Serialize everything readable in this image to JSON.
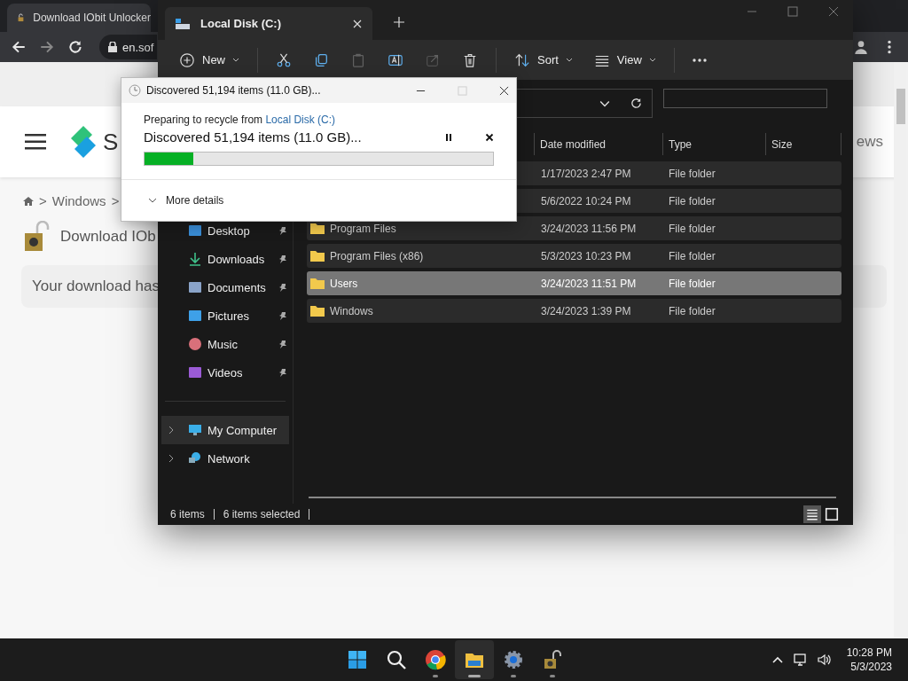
{
  "browser": {
    "tab_title": "Download IObit Unlocker",
    "address": "en.sof",
    "logo_text": "S",
    "breadcrumb": [
      ">",
      "Windows",
      ">"
    ],
    "page_title": "Download IOb",
    "notice": "Your download has",
    "side_text": "ews"
  },
  "explorer": {
    "tabs": [
      {
        "label": "Local Disk (C:)",
        "selected": true
      }
    ],
    "toolbar": [
      {
        "kind": "new",
        "label": "New",
        "disabled": false
      },
      {
        "kind": "cut",
        "disabled": false
      },
      {
        "kind": "copy",
        "disabled": false
      },
      {
        "kind": "paste",
        "disabled": true
      },
      {
        "kind": "rename",
        "disabled": false
      },
      {
        "kind": "share",
        "disabled": true
      },
      {
        "kind": "delete",
        "disabled": false
      },
      {
        "kind": "sort",
        "label": "Sort",
        "disabled": false
      },
      {
        "kind": "view",
        "label": "View",
        "disabled": false
      },
      {
        "kind": "more",
        "disabled": false
      }
    ],
    "columns": [
      "Date modified",
      "Type",
      "Size"
    ],
    "rows": [
      {
        "date": "1/17/2023 2:47 PM",
        "type": "File folder",
        "selected": true,
        "hovered": false
      },
      {
        "date": "5/6/2022 10:24 PM",
        "type": "File folder",
        "selected": true,
        "hovered": false
      },
      {
        "name": "Program Files",
        "date": "3/24/2023 11:56 PM",
        "type": "File folder",
        "selected": true,
        "hovered": false
      },
      {
        "name": "Program Files (x86)",
        "date": "5/3/2023 10:23 PM",
        "type": "File folder",
        "selected": true,
        "hovered": false
      },
      {
        "name": "Users",
        "date": "3/24/2023 11:51 PM",
        "type": "File folder",
        "selected": true,
        "hovered": true
      },
      {
        "name": "Windows",
        "date": "3/24/2023 1:39 PM",
        "type": "File folder",
        "selected": true,
        "hovered": false
      }
    ],
    "quick_access": [
      {
        "kind": "desktop",
        "label": "Desktop",
        "pinned": true
      },
      {
        "kind": "downloads",
        "label": "Downloads",
        "pinned": true
      },
      {
        "kind": "documents",
        "label": "Documents",
        "pinned": true
      },
      {
        "kind": "pictures",
        "label": "Pictures",
        "pinned": true
      },
      {
        "kind": "music",
        "label": "Music",
        "pinned": true
      },
      {
        "kind": "videos",
        "label": "Videos",
        "pinned": true
      }
    ],
    "locations": [
      {
        "kind": "computer",
        "label": "My Computer",
        "selected": true,
        "expanded": false
      },
      {
        "kind": "network",
        "label": "Network",
        "selected": false,
        "expanded": false
      }
    ],
    "status": [
      "6 items",
      "6 items selected"
    ],
    "views": [
      {
        "kind": "details",
        "selected": true
      },
      {
        "kind": "tiles",
        "selected": false
      }
    ]
  },
  "dialog": {
    "title": "Discovered 51,194 items (11.0 GB)...",
    "from_text": "Preparing to recycle from",
    "from_link": "Local Disk (C:)",
    "status": "Discovered 51,194 items (11.0 GB)...",
    "level": 0.14,
    "more": "More details"
  },
  "taskbar": {
    "apps": [
      {
        "kind": "start",
        "running": false,
        "active": false
      },
      {
        "kind": "search",
        "running": false,
        "active": false
      },
      {
        "kind": "chrome",
        "running": true,
        "active": false
      },
      {
        "kind": "explorer",
        "running": true,
        "active": true
      },
      {
        "kind": "settings",
        "running": true,
        "active": false
      },
      {
        "kind": "unlocker",
        "running": true,
        "active": false
      }
    ],
    "time": "10:28 PM",
    "date": "5/3/2023"
  }
}
